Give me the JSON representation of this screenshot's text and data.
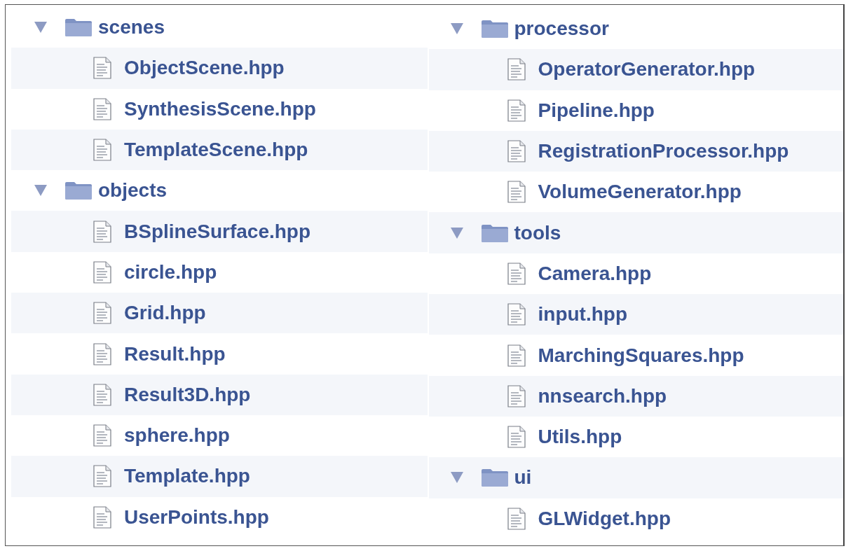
{
  "panes": [
    {
      "folders": [
        {
          "name": "scenes",
          "expanded": true,
          "children": [
            {
              "name": "ObjectScene.hpp"
            },
            {
              "name": "SynthesisScene.hpp"
            },
            {
              "name": "TemplateScene.hpp"
            }
          ]
        },
        {
          "name": "objects",
          "expanded": true,
          "children": [
            {
              "name": "BSplineSurface.hpp"
            },
            {
              "name": "circle.hpp"
            },
            {
              "name": "Grid.hpp"
            },
            {
              "name": "Result.hpp"
            },
            {
              "name": "Result3D.hpp"
            },
            {
              "name": "sphere.hpp"
            },
            {
              "name": "Template.hpp"
            },
            {
              "name": "UserPoints.hpp"
            }
          ]
        }
      ]
    },
    {
      "folders": [
        {
          "name": "processor",
          "expanded": true,
          "children": [
            {
              "name": "OperatorGenerator.hpp"
            },
            {
              "name": "Pipeline.hpp"
            },
            {
              "name": "RegistrationProcessor.hpp"
            },
            {
              "name": "VolumeGenerator.hpp"
            }
          ]
        },
        {
          "name": "tools",
          "expanded": true,
          "children": [
            {
              "name": "Camera.hpp"
            },
            {
              "name": "input.hpp"
            },
            {
              "name": "MarchingSquares.hpp"
            },
            {
              "name": "nnsearch.hpp"
            },
            {
              "name": "Utils.hpp"
            }
          ]
        },
        {
          "name": "ui",
          "expanded": true,
          "children": [
            {
              "name": "GLWidget.hpp"
            }
          ]
        }
      ]
    }
  ]
}
